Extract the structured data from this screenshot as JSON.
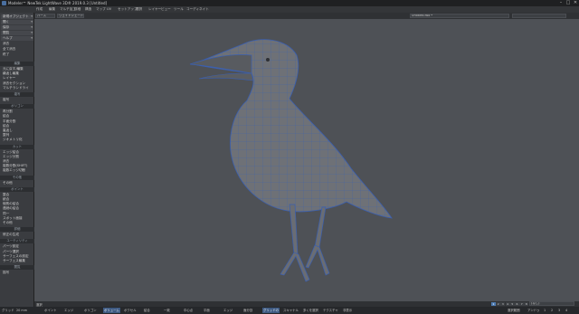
{
  "window": {
    "title": "Modeler™ NewTek LightWave 3D® 2019.0.3 [Untitled]",
    "controls": [
      "–",
      "□",
      "✕"
    ]
  },
  "menu_tabs": [
    "作成",
    "編集",
    "マルチ加工",
    "詳細",
    "構造",
    "マップ",
    "UV",
    "セットアップ",
    "選択",
    "レイヤー",
    "ビュー",
    "ツール",
    "コーディネイト"
  ],
  "viewbar": {
    "view_mode": "パース",
    "shading": "ウェイトシェード",
    "layer": "Untitled.lwo *"
  },
  "left_panel": {
    "top_items": [
      {
        "label": "新規オブジェクト",
        "dropdown": true
      },
      {
        "label": "開く",
        "dropdown": true
      },
      {
        "label": "保存",
        "dropdown": true
      },
      {
        "label": "閲覧",
        "dropdown": true
      },
      {
        "label": "ヘルプ",
        "dropdown": true
      },
      {
        "label": "消去",
        "dropdown": false
      },
      {
        "label": "全て消去",
        "dropdown": false
      },
      {
        "label": "終了",
        "dropdown": false
      }
    ],
    "sections": [
      {
        "header": "編集",
        "items": [
          "元に戻す/編集",
          "繰返し編集",
          "レイヤー",
          "消去セクション",
          "マルチランドライ"
        ]
      },
      {
        "header": "複写",
        "items": [
          "複写"
        ]
      },
      {
        "header": "ポリゴン",
        "items": [
          "再分割",
          "結合",
          "平面分割",
          "結合",
          "裏返し",
          "整列",
          "ジオメトリ化"
        ]
      },
      {
        "header": "カット",
        "items": [
          "エッジ結合",
          "エッジ分割",
          "消去",
          "複数分割(SHIFT)",
          "複数エッジ切断"
        ]
      },
      {
        "header": "その他",
        "items": [
          "その他"
        ]
      },
      {
        "header": "ポイント",
        "items": [
          "整合",
          "統合",
          "個別の結合",
          "連続の結合",
          "同一",
          "スポット面接",
          "その他"
        ]
      },
      {
        "header": "詳細",
        "items": [
          "修正の生成"
        ]
      },
      {
        "header": "ユーティリティ",
        "items": [
          "パーツ設定",
          "パーツ選択",
          "サーフェスの設定",
          "サーフェス編集"
        ]
      },
      {
        "header": "閲覧",
        "items": [
          "描写"
        ]
      }
    ]
  },
  "statusbar": {
    "left_label": "選択",
    "buttons": [
      "1",
      "2",
      "3",
      "4",
      "5",
      "6",
      "7",
      "8"
    ],
    "right_field": "(なし)"
  },
  "bottombar": {
    "grid_label": "グリッド",
    "grid_value": "20 mm",
    "modes": [
      "ポイント",
      "エッジ",
      "ポリゴン",
      "ボリューム",
      "ボクセル"
    ],
    "tools": [
      "結合",
      "一致",
      "中心点",
      "平面",
      "エッジ",
      "面分割",
      "グリッドの",
      "スキャナル",
      "多くを選択",
      "テクスチャ",
      "非表示"
    ],
    "right_labels": [
      "選択範囲",
      "アンドゥ"
    ],
    "right_numbers": [
      "1",
      "2",
      "3",
      "4"
    ]
  },
  "colors": {
    "viewport_bg": "#4e5156",
    "mesh_fill": "#6e7177",
    "wire": "#3a5fb0",
    "active_mode": "#3e5a82"
  }
}
